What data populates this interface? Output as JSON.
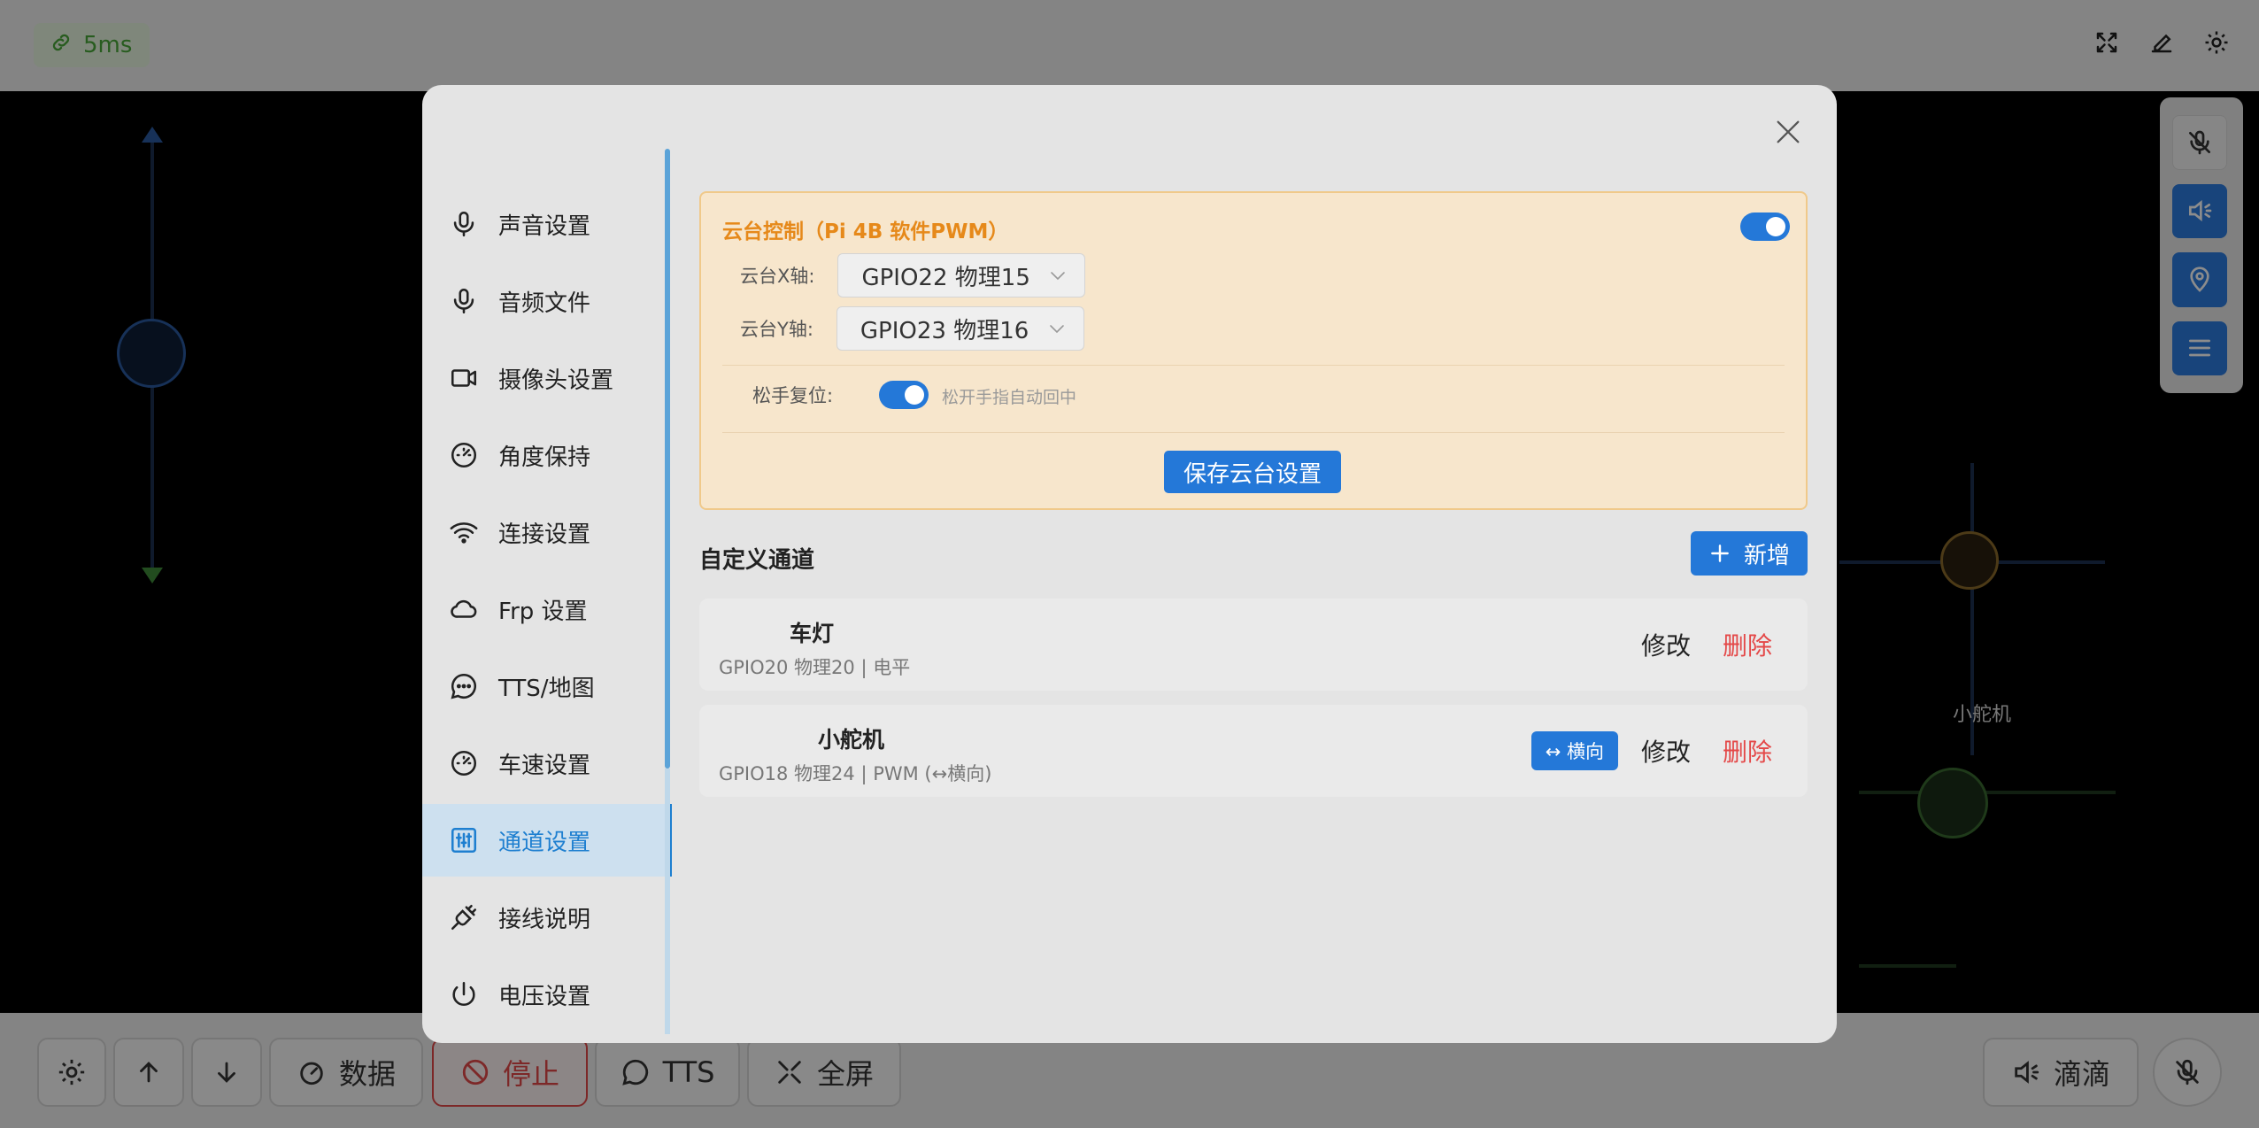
{
  "topbar": {
    "latency": "5ms"
  },
  "bottombar": {
    "data_label": "数据",
    "stop_label": "停止",
    "tts_label": "TTS",
    "fullscreen_label": "全屏",
    "didi_label": "滴滴"
  },
  "stage": {
    "servo_label": "小舵机"
  },
  "sidebar": {
    "items": [
      {
        "label": "声音设置",
        "icon": "microphone-icon"
      },
      {
        "label": "音频文件",
        "icon": "microphone-icon"
      },
      {
        "label": "摄像头设置",
        "icon": "camera-icon"
      },
      {
        "label": "角度保持",
        "icon": "gauge-icon"
      },
      {
        "label": "连接设置",
        "icon": "wifi-icon"
      },
      {
        "label": "Frp 设置",
        "icon": "cloud-icon"
      },
      {
        "label": "TTS/地图",
        "icon": "chat-icon"
      },
      {
        "label": "车速设置",
        "icon": "gauge-icon"
      },
      {
        "label": "通道设置",
        "icon": "sliders-icon",
        "active": true
      },
      {
        "label": "接线说明",
        "icon": "plug-icon"
      },
      {
        "label": "电压设置",
        "icon": "power-icon"
      }
    ]
  },
  "ptz": {
    "title": "云台控制（Pi 4B 软件PWM）",
    "enabled": true,
    "x_axis_label": "云台X轴:",
    "x_axis_value": "GPIO22 物理15",
    "y_axis_label": "云台Y轴:",
    "y_axis_value": "GPIO23 物理16",
    "reset_label": "松手复位:",
    "reset_enabled": true,
    "reset_hint": "松开手指自动回中",
    "save_label": "保存云台设置"
  },
  "channels": {
    "title": "自定义通道",
    "add_label": "新增",
    "edit_label": "修改",
    "delete_label": "删除",
    "items": [
      {
        "name": "车灯",
        "meta": "GPIO20 物理20 | 电平"
      },
      {
        "name": "小舵机",
        "meta": "GPIO18 物理24 | PWM (↔横向)",
        "direction": "↔ 横向"
      }
    ]
  },
  "colors": {
    "accent": "#2478d8",
    "ptz_title": "#e6891a",
    "danger": "#e44848",
    "latency_green": "#49a83a"
  }
}
